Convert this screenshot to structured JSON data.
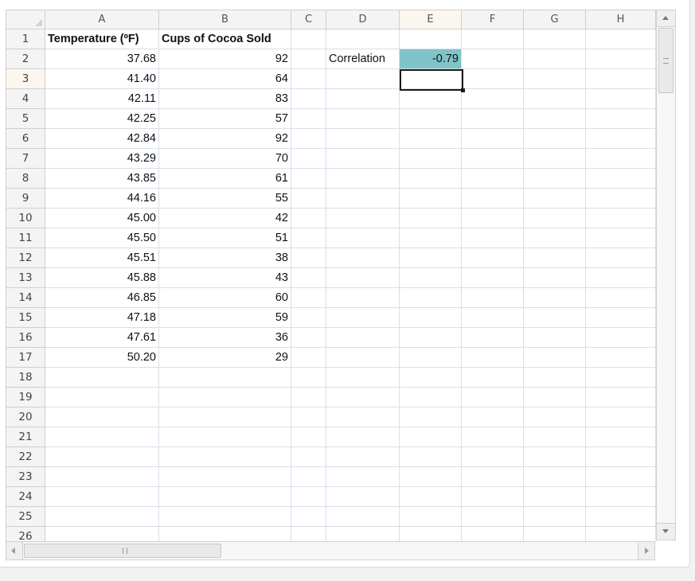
{
  "sheet": {
    "columns": [
      "A",
      "B",
      "C",
      "D",
      "E",
      "F",
      "G",
      "H"
    ],
    "rows": [
      "1",
      "2",
      "3",
      "4",
      "5",
      "6",
      "7",
      "8",
      "9",
      "10",
      "11",
      "12",
      "13",
      "14",
      "15",
      "16",
      "17",
      "18",
      "19",
      "20",
      "21",
      "22",
      "23",
      "24",
      "25",
      "26"
    ],
    "selected_cell": "E3",
    "headers": {
      "a1": "Temperature (ºF)",
      "b1": "Cups of Cocoa Sold"
    },
    "data": [
      [
        "37.68",
        "92"
      ],
      [
        "41.40",
        "64"
      ],
      [
        "42.11",
        "83"
      ],
      [
        "42.25",
        "57"
      ],
      [
        "42.84",
        "92"
      ],
      [
        "43.29",
        "70"
      ],
      [
        "43.85",
        "61"
      ],
      [
        "44.16",
        "55"
      ],
      [
        "45.00",
        "42"
      ],
      [
        "45.50",
        "51"
      ],
      [
        "45.51",
        "38"
      ],
      [
        "45.88",
        "43"
      ],
      [
        "46.85",
        "60"
      ],
      [
        "47.18",
        "59"
      ],
      [
        "47.61",
        "36"
      ],
      [
        "50.20",
        "29"
      ]
    ],
    "correlation_label": "Correlation",
    "correlation_value": "-0.79"
  },
  "colors": {
    "highlight_cell": "#7fc4c9",
    "header_bg": "#f4f4f4",
    "selected_header_bg": "#fbf7ee",
    "gridline": "#d6dfe9"
  },
  "scrollbars": {
    "vertical_grip_icon": "grip-lines-icon",
    "horizontal_grip_icon": "grip-lines-icon"
  }
}
